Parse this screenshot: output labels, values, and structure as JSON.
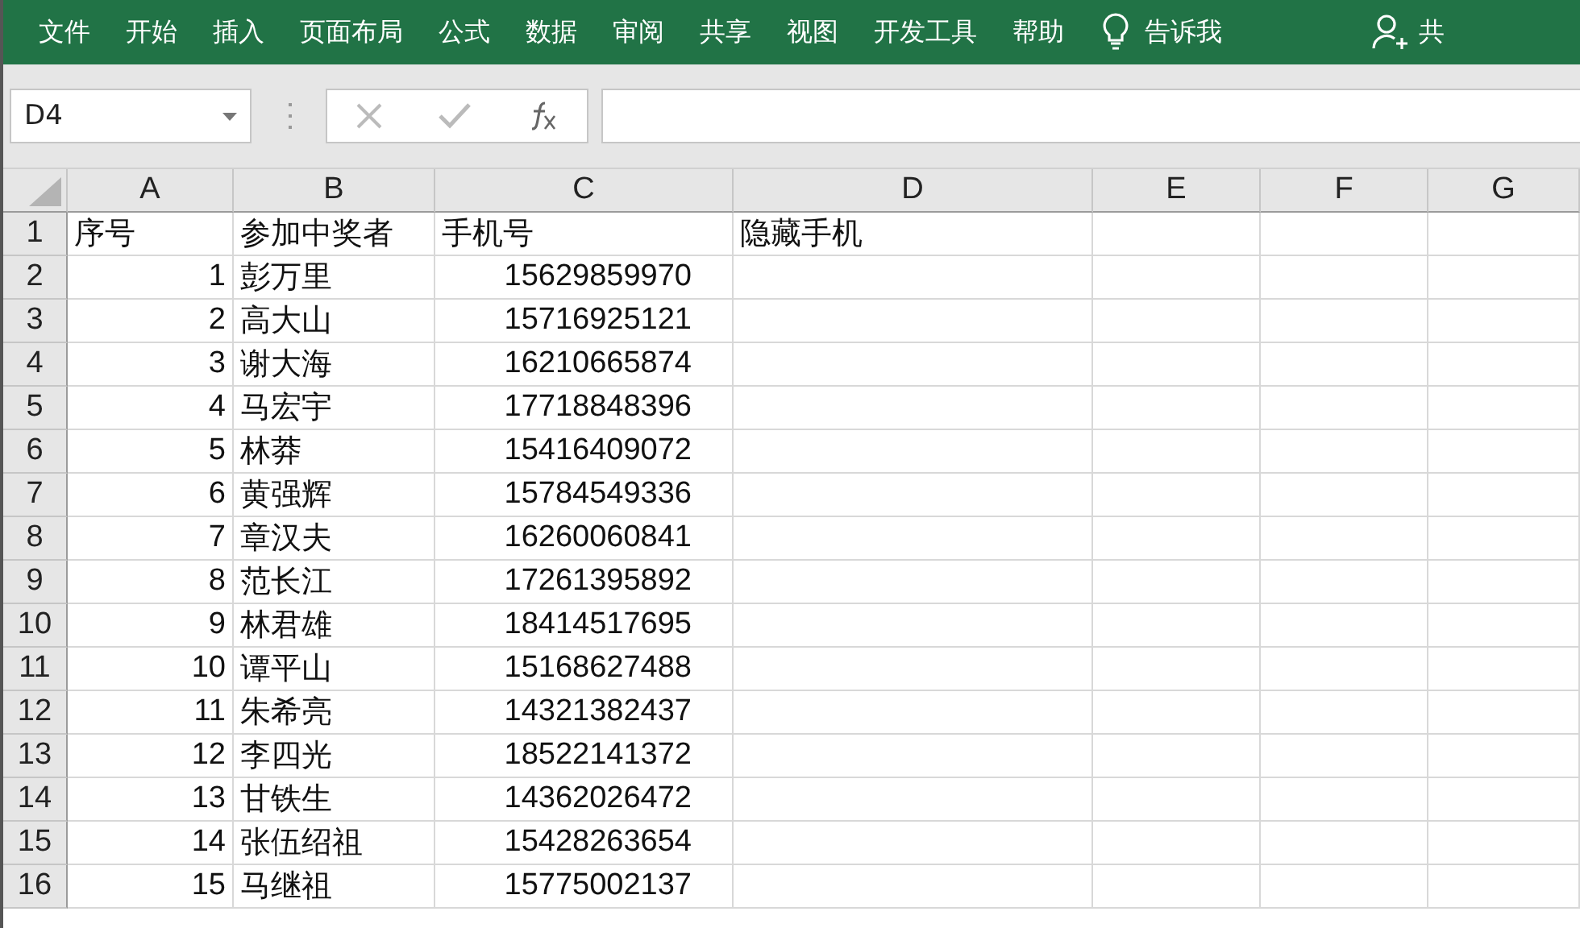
{
  "ribbon": {
    "tabs": [
      "文件",
      "开始",
      "插入",
      "页面布局",
      "公式",
      "数据",
      "审阅",
      "共享",
      "视图",
      "开发工具",
      "帮助"
    ],
    "tell_me": "告诉我",
    "share": "共"
  },
  "formula_bar": {
    "name_box": "D4"
  },
  "columns": [
    "A",
    "B",
    "C",
    "D",
    "E",
    "F",
    "G"
  ],
  "rows": [
    {
      "number": "1",
      "kind": "header",
      "cells": [
        "序号",
        "参加中奖者",
        "手机号",
        "隐藏手机"
      ]
    },
    {
      "number": "2",
      "kind": "data",
      "cells": [
        "1",
        "彭万里",
        "15629859970"
      ]
    },
    {
      "number": "3",
      "kind": "data",
      "cells": [
        "2",
        "高大山",
        "15716925121"
      ]
    },
    {
      "number": "4",
      "kind": "data",
      "cells": [
        "3",
        "谢大海",
        "16210665874"
      ]
    },
    {
      "number": "5",
      "kind": "data",
      "cells": [
        "4",
        "马宏宇",
        "17718848396"
      ]
    },
    {
      "number": "6",
      "kind": "data",
      "cells": [
        "5",
        "林莽",
        "15416409072"
      ]
    },
    {
      "number": "7",
      "kind": "data",
      "cells": [
        "6",
        "黄强辉",
        "15784549336"
      ]
    },
    {
      "number": "8",
      "kind": "data",
      "cells": [
        "7",
        "章汉夫",
        "16260060841"
      ]
    },
    {
      "number": "9",
      "kind": "data",
      "cells": [
        "8",
        "范长江",
        "17261395892"
      ]
    },
    {
      "number": "10",
      "kind": "data",
      "cells": [
        "9",
        "林君雄",
        "18414517695"
      ]
    },
    {
      "number": "11",
      "kind": "data",
      "cells": [
        "10",
        "谭平山",
        "15168627488"
      ]
    },
    {
      "number": "12",
      "kind": "data",
      "cells": [
        "11",
        "朱希亮",
        "14321382437"
      ]
    },
    {
      "number": "13",
      "kind": "data",
      "cells": [
        "12",
        "李四光",
        "18522141372"
      ]
    },
    {
      "number": "14",
      "kind": "data",
      "cells": [
        "13",
        "甘铁生",
        "14362026472"
      ]
    },
    {
      "number": "15",
      "kind": "data",
      "cells": [
        "14",
        "张伍绍祖",
        "15428263654"
      ]
    },
    {
      "number": "16",
      "kind": "data",
      "cells": [
        "15",
        "马继祖",
        "15775002137"
      ]
    }
  ]
}
